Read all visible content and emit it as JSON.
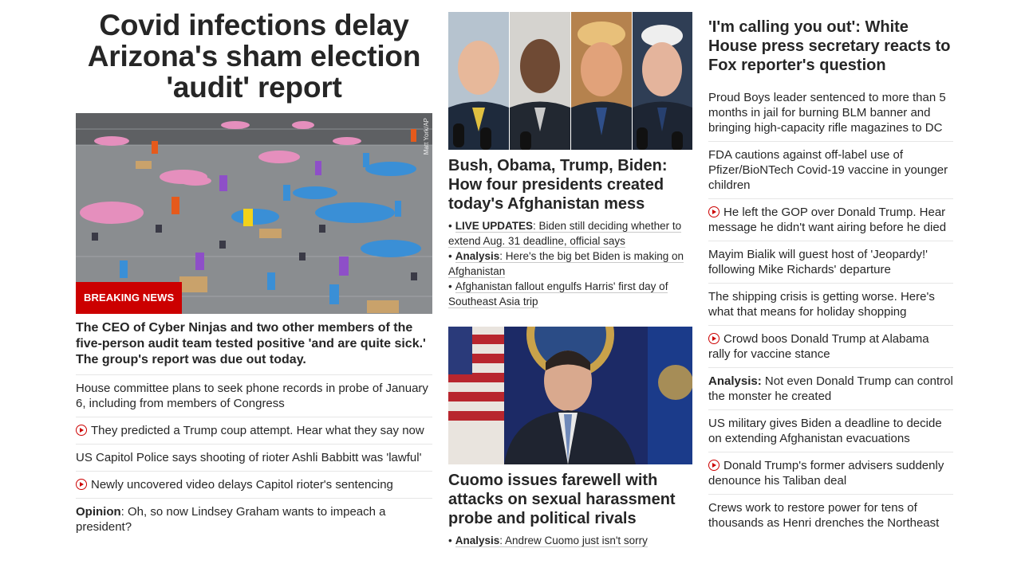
{
  "column1": {
    "headline": "Covid infections delay Arizona's sham election 'audit' report",
    "badge": "BREAKING NEWS",
    "photo_credit": "Matt York/AP",
    "summary": "The CEO of Cyber Ninjas and two other members of the five-person audit team tested positive 'and are quite sick.' The group's report was due out today.",
    "links": [
      {
        "text": "House committee plans to seek phone records in probe of January 6, including from members of Congress"
      },
      {
        "text": "They predicted a Trump coup attempt. Hear what they say now",
        "video": true
      },
      {
        "text": "US Capitol Police says shooting of rioter Ashli Babbitt was 'lawful'"
      },
      {
        "text": "Newly uncovered video delays Capitol rioter's sentencing",
        "video": true
      },
      {
        "prefix": "Opinion",
        "text": ": Oh, so now Lindsey Graham wants to impeach a president?"
      }
    ]
  },
  "column2": {
    "story1": {
      "headline": "Bush, Obama, Trump, Biden: How four presidents created today's Afghanistan mess",
      "bullets": [
        {
          "prefix": "LIVE UPDATES",
          "text": ": Biden still deciding whether to extend Aug. 31 deadline, official says"
        },
        {
          "prefix": "Analysis",
          "text": ": Here's the big bet Biden is making on Afghanistan"
        },
        {
          "prefix": "",
          "text": "Afghanistan fallout engulfs Harris' first day of Southeast Asia trip"
        }
      ]
    },
    "story2": {
      "headline": "Cuomo issues farewell with attacks on sexual harassment probe and political rivals",
      "bullets": [
        {
          "prefix": "Analysis",
          "text": ": Andrew Cuomo just isn't sorry"
        }
      ]
    }
  },
  "column3": {
    "headline": "'I'm calling you out': White House press secretary reacts to Fox reporter's question",
    "links": [
      {
        "text": "Proud Boys leader sentenced to more than 5 months in jail for burning BLM banner and bringing high-capacity rifle magazines to DC"
      },
      {
        "text": "FDA cautions against off-label use of Pfizer/BioNTech Covid-19 vaccine in younger children"
      },
      {
        "text": "He left the GOP over Donald Trump. Hear message he didn't want airing before he died",
        "video": true
      },
      {
        "text": "Mayim Bialik will guest host of 'Jeopardy!' following Mike Richards' departure"
      },
      {
        "text": "The shipping crisis is getting worse. Here's what that means for holiday shopping"
      },
      {
        "text": "Crowd boos Donald Trump at Alabama rally for vaccine stance",
        "video": true
      },
      {
        "prefix": "Analysis:",
        "text": " Not even Donald Trump can control the monster he created"
      },
      {
        "text": "US military gives Biden a deadline to decide on extending Afghanistan evacuations"
      },
      {
        "text": "Donald Trump's former advisers suddenly denounce his Taliban deal",
        "video": true
      },
      {
        "text": "Crews work to restore power for tens of thousands as Henri drenches the Northeast"
      }
    ]
  },
  "colors": {
    "accent_red": "#cc0000",
    "text": "#262626",
    "divider": "#e6e6e6"
  }
}
